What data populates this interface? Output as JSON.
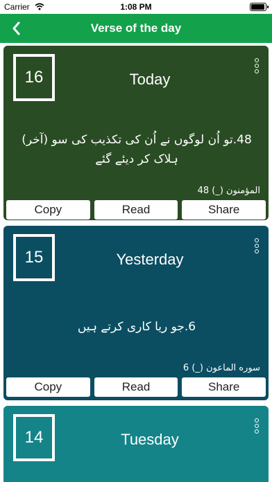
{
  "status": {
    "carrier": "Carrier",
    "time": "1:08 PM",
    "battery_level": 1.0
  },
  "nav": {
    "title": "Verse of the day"
  },
  "cards": [
    {
      "day_number": "16",
      "day_label": "Today",
      "verse": "48.تو اُن لوگوں نے اُن کی تکذیب کی سو (آخر) ہلاک کر دیئے گئے",
      "reference": "المؤمنون (_) 48",
      "color": "#2a4c24",
      "actions": {
        "copy": "Copy",
        "read": "Read",
        "share": "Share"
      }
    },
    {
      "day_number": "15",
      "day_label": "Yesterday",
      "verse": "6.جو ریا کاری کرتے ہیں",
      "reference": "سوره الماعون (_) 6",
      "color": "#0b4e62",
      "actions": {
        "copy": "Copy",
        "read": "Read",
        "share": "Share"
      }
    },
    {
      "day_number": "14",
      "day_label": "Tuesday",
      "color": "#158489"
    }
  ]
}
